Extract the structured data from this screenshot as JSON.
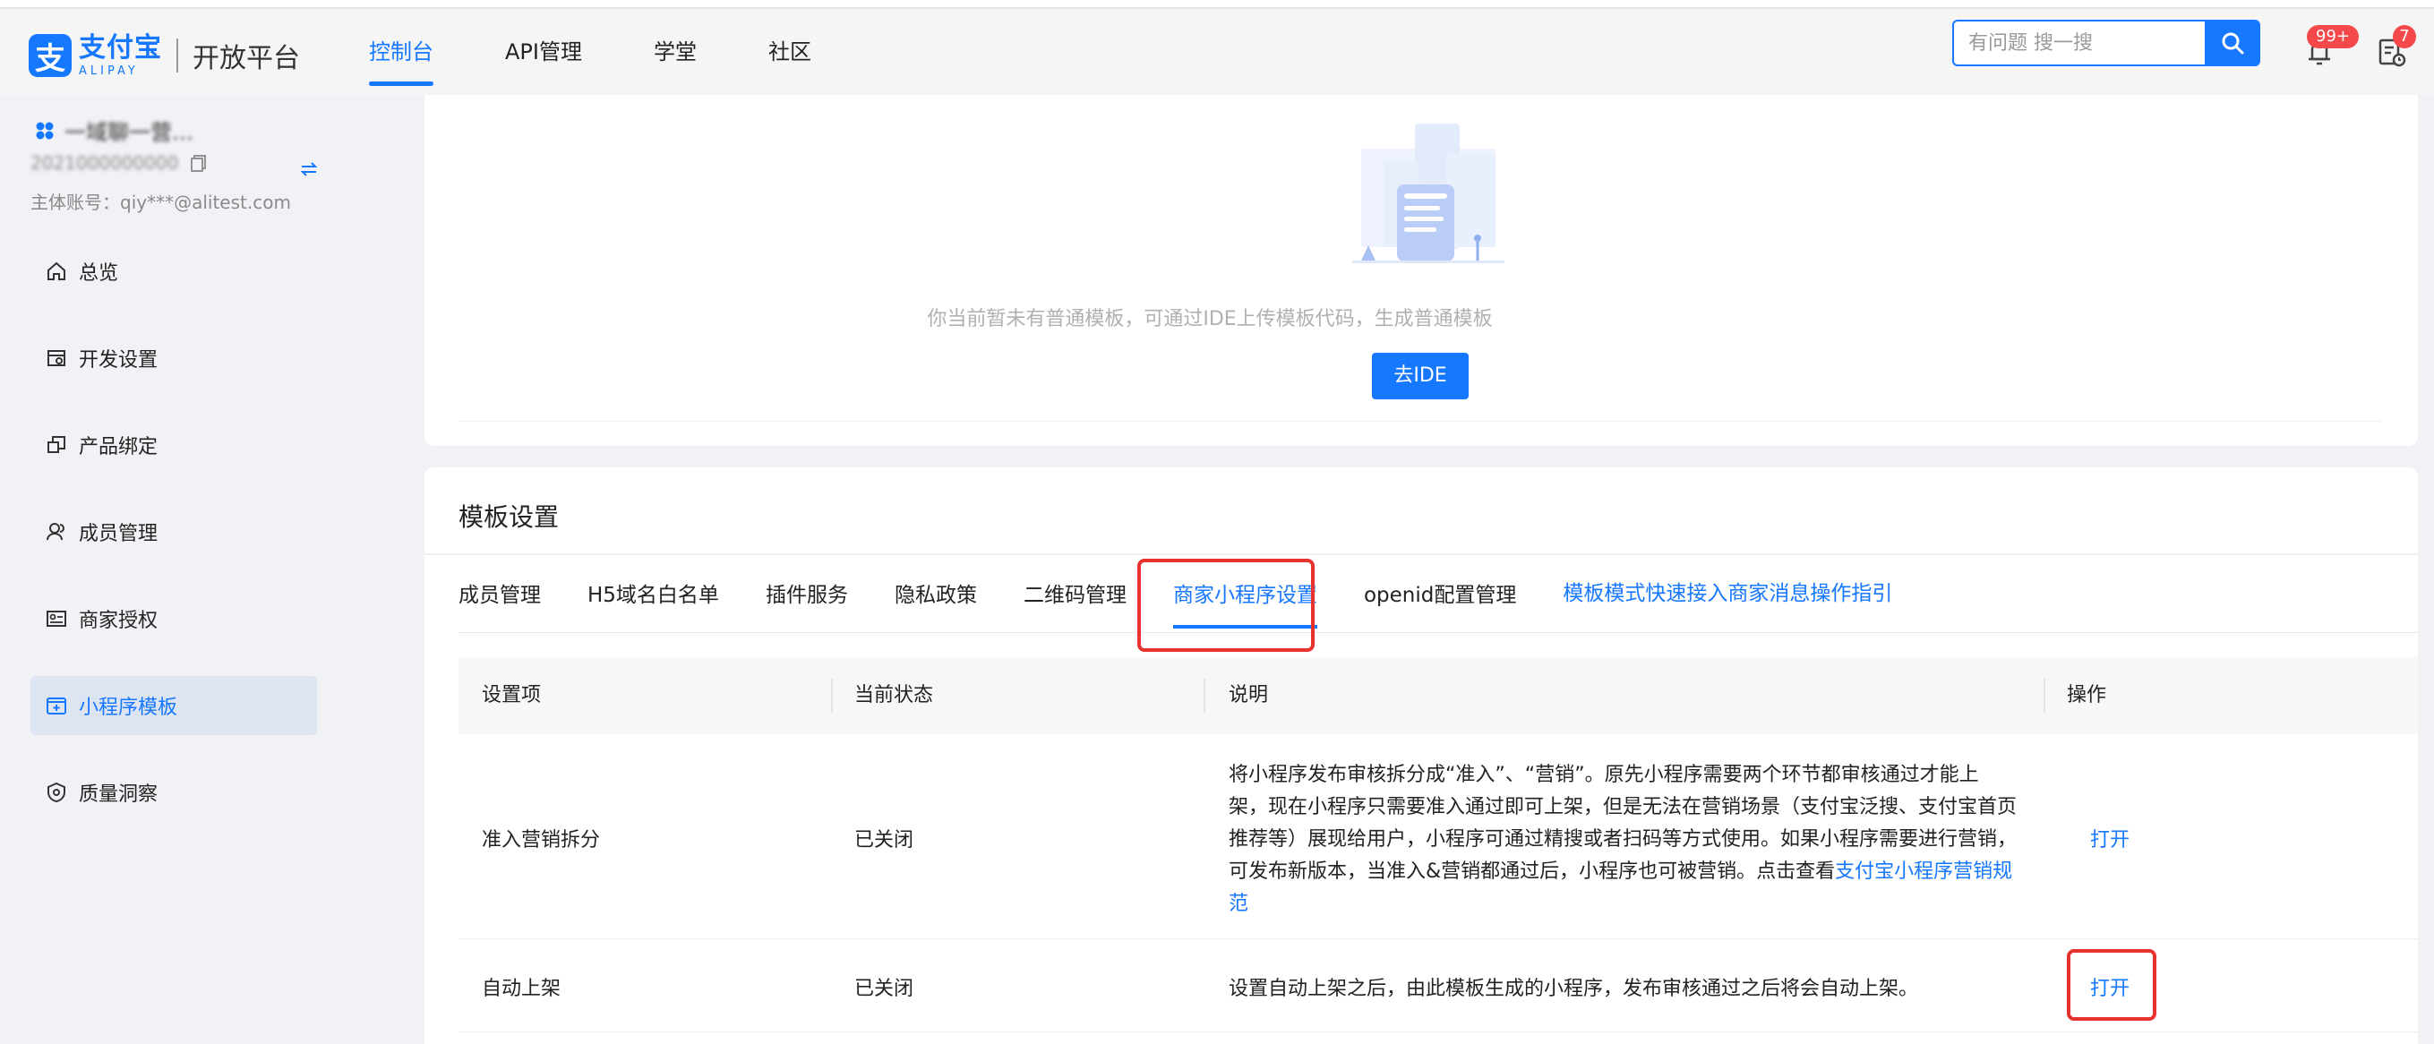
{
  "header": {
    "logo_cn": "支付宝",
    "logo_en": "ALIPAY",
    "platform": "开放平台",
    "nav": [
      "控制台",
      "API管理",
      "学堂",
      "社区"
    ],
    "search_placeholder": "有问题 搜一搜",
    "bell_badge": "99+",
    "todo_badge": "7"
  },
  "account": {
    "name": "一域聊一营…",
    "id": "2021000000000",
    "main_account": "主体账号：qiy***@alitest.com"
  },
  "sidebar": {
    "items": [
      {
        "label": "总览",
        "icon": "home-icon"
      },
      {
        "label": "开发设置",
        "icon": "dev-settings-icon"
      },
      {
        "label": "产品绑定",
        "icon": "product-bind-icon"
      },
      {
        "label": "成员管理",
        "icon": "members-icon"
      },
      {
        "label": "商家授权",
        "icon": "merchant-auth-icon"
      },
      {
        "label": "小程序模板",
        "icon": "template-icon"
      },
      {
        "label": "质量洞察",
        "icon": "quality-icon"
      }
    ],
    "active_index": 5
  },
  "empty": {
    "text": "你当前暂未有普通模板，可通过IDE上传模板代码，生成普通模板",
    "button": "去IDE"
  },
  "settings": {
    "title": "模板设置",
    "tabs": [
      "成员管理",
      "H5域名白名单",
      "插件服务",
      "隐私政策",
      "二维码管理",
      "商家小程序设置",
      "openid配置管理"
    ],
    "active_tab": 5,
    "guide_link": "模板模式快速接入商家消息操作指引",
    "table": {
      "headers": [
        "设置项",
        "当前状态",
        "说明",
        "操作"
      ],
      "rows": [
        {
          "item": "准入营销拆分",
          "status": "已关闭",
          "desc": "将小程序发布审核拆分成“准入”、“营销”。原先小程序需要两个环节都审核通过才能上架，现在小程序只需要准入通过即可上架，但是无法在营销场景（支付宝泛搜、支付宝首页推荐等）展现给用户，小程序可通过精搜或者扫码等方式使用。如果小程序需要进行营销，可发布新版本，当准入&营销都通过后，小程序也可被营销。点击查看",
          "desc_link": "支付宝小程序营销规范",
          "action": "打开"
        },
        {
          "item": "自动上架",
          "status": "已关闭",
          "desc": "设置自动上架之后，由此模板生成的小程序，发布审核通过之后将会自动上架。",
          "action": "打开"
        }
      ]
    }
  },
  "colors": {
    "accent": "#1677ff",
    "highlight": "#e8322f",
    "badge": "#f5484a"
  }
}
